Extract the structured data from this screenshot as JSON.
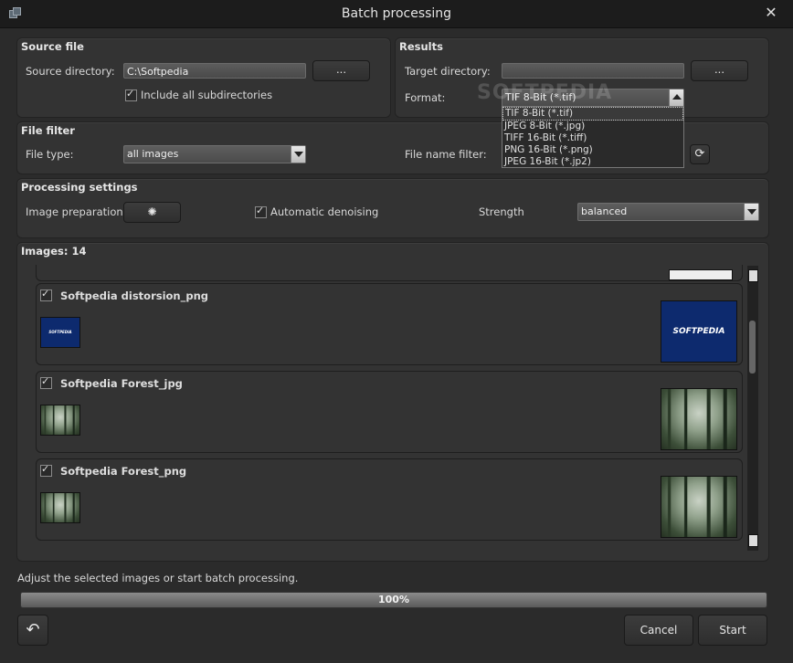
{
  "window": {
    "title": "Batch processing"
  },
  "source": {
    "title": "Source file",
    "dir_label": "Source directory:",
    "dir_value": "C:\\Softpedia",
    "browse_label": "...",
    "subdirs_label": "Include all subdirectories",
    "subdirs_checked": true
  },
  "results": {
    "title": "Results",
    "target_label": "Target directory:",
    "target_value": "",
    "browse_label": "...",
    "format_label": "Format:",
    "format_value": "TIF 8-Bit (*.tif)",
    "format_options": [
      "TIF 8-Bit (*.tif)",
      "JPEG 8-Bit (*.jpg)",
      "TIFF 16-Bit (*.tiff)",
      "PNG 16-Bit (*.png)",
      "JPEG 16-Bit (*.jp2)"
    ]
  },
  "watermark": "SOFTPEDIA",
  "filter": {
    "title": "File filter",
    "type_label": "File type:",
    "type_value": "all images",
    "name_label": "File name filter:"
  },
  "processing": {
    "title": "Processing settings",
    "prep_label": "Image preparation:",
    "denoise_label": "Automatic denoising",
    "denoise_checked": true,
    "strength_label": "Strength",
    "strength_value": "balanced"
  },
  "images": {
    "title": "Images: 14",
    "items": [
      {
        "name": "Softpedia distorsion_png",
        "thumb_text": "SOFTPEDIA",
        "kind": "softpedia",
        "checked": true
      },
      {
        "name": "Softpedia Forest_jpg",
        "kind": "forest",
        "checked": true
      },
      {
        "name": "Softpedia Forest_png",
        "kind": "forest",
        "checked": true
      }
    ]
  },
  "status": {
    "message": "Adjust the selected images or start batch processing.",
    "progress_text": "100%",
    "progress": 1.0
  },
  "buttons": {
    "cancel": "Cancel",
    "start": "Start"
  }
}
